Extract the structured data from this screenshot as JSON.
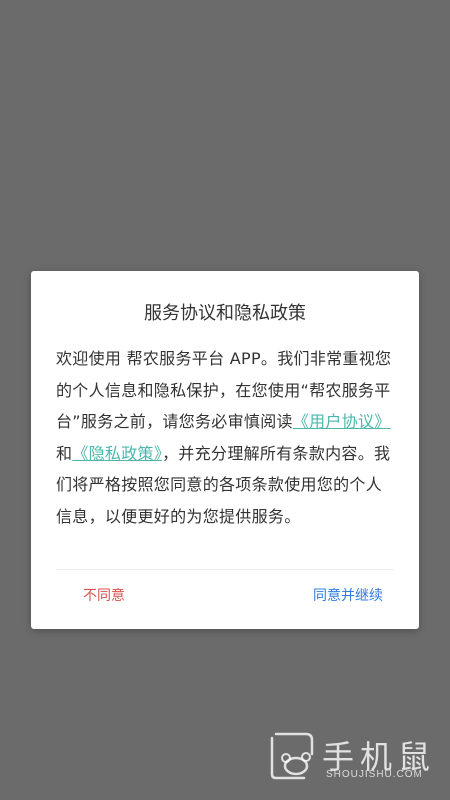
{
  "dialog": {
    "title": "服务协议和隐私政策",
    "body_before": "欢迎使用 帮农服务平台 APP。我们非常重视您的个人信息和隐私保护，在您使用“帮农服务平台”服务之前，请您务必审慎阅读",
    "user_agreement_link": "《用户协议》",
    "conjunction": "和",
    "privacy_policy_link": "《隐私政策》",
    "body_after": "，并充分理解所有条款内容。我们将严格按照您同意的各项条款使用您的个人信息，以便更好的为您提供服务。",
    "disagree_label": "不同意",
    "agree_label": "同意并继续"
  },
  "watermark": {
    "brand": "手机鼠",
    "site": "SHOUJISHU.COM"
  },
  "colors": {
    "overlay": "#6b6b6b",
    "link": "#4db6ac",
    "disagree": "#d9534f",
    "agree": "#2f7ce0"
  }
}
